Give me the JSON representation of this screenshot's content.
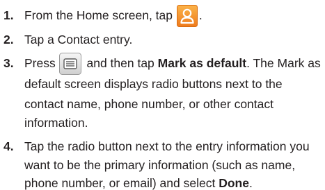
{
  "steps": [
    {
      "number": "1.",
      "line1_before": "From the Home screen, tap",
      "line1_after": "."
    },
    {
      "number": "2.",
      "line1": "Tap a Contact entry."
    },
    {
      "number": "3.",
      "line1_before": "Press",
      "line1_middle": "and then tap",
      "line1_bold": "Mark as default",
      "line1_after": ". The Mark as",
      "lines": [
        "default screen displays radio buttons next to the",
        "contact name, phone number, or other contact",
        "information."
      ]
    },
    {
      "number": "4.",
      "lines": [
        "Tap the radio button next to the entry information you",
        "want to be the primary information (such as name,"
      ],
      "last_line_before": "phone number, or email) and select",
      "last_line_bold": "Done",
      "last_line_after": "."
    }
  ],
  "icons": {
    "contacts": "contacts-app-icon",
    "menu": "menu-key-icon"
  },
  "colors": {
    "text": "#231f20",
    "contacts_icon_top": "#fbb44a",
    "contacts_icon_bottom": "#ee7a1c",
    "menu_icon_top": "#f7f7f7",
    "menu_icon_bottom": "#cfcfcf"
  }
}
